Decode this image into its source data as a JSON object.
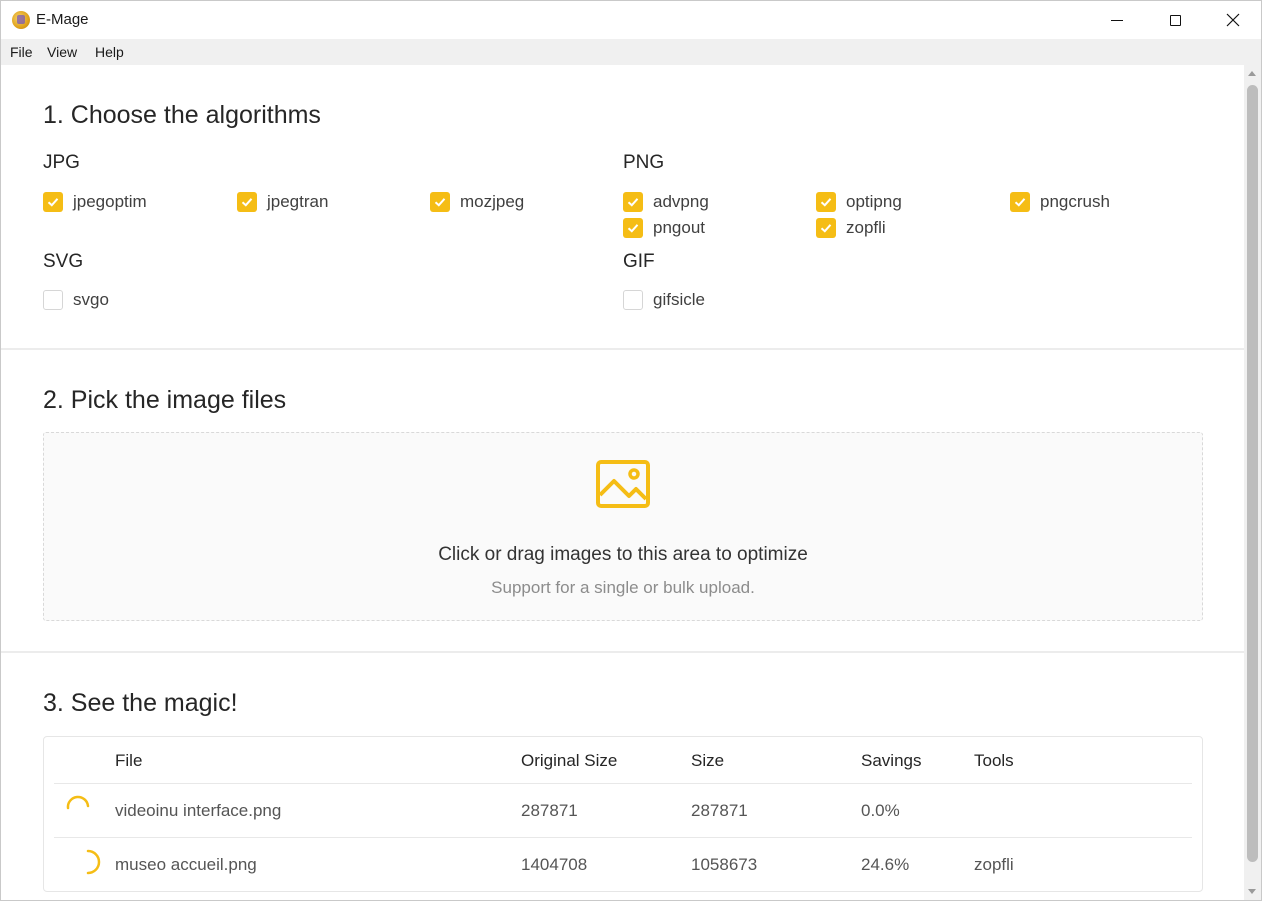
{
  "window": {
    "title": "E-Mage"
  },
  "menu": {
    "items": [
      "File",
      "View",
      "Help"
    ]
  },
  "section1": {
    "title": "1. Choose the algorithms",
    "groups": [
      {
        "name": "JPG",
        "options": [
          {
            "label": "jpegoptim",
            "checked": true
          },
          {
            "label": "jpegtran",
            "checked": true
          },
          {
            "label": "mozjpeg",
            "checked": true
          }
        ]
      },
      {
        "name": "PNG",
        "options": [
          {
            "label": "advpng",
            "checked": true
          },
          {
            "label": "optipng",
            "checked": true
          },
          {
            "label": "pngcrush",
            "checked": true
          },
          {
            "label": "pngout",
            "checked": true
          },
          {
            "label": "zopfli",
            "checked": true
          }
        ]
      },
      {
        "name": "SVG",
        "options": [
          {
            "label": "svgo",
            "checked": false
          }
        ]
      },
      {
        "name": "GIF",
        "options": [
          {
            "label": "gifsicle",
            "checked": false
          }
        ]
      }
    ]
  },
  "section2": {
    "title": "2. Pick the image files",
    "dropzone": {
      "icon": "image-icon",
      "text": "Click or drag images to this area to optimize",
      "hint": "Support for a single or bulk upload."
    }
  },
  "section3": {
    "title": "3. See the magic!",
    "columns": [
      "File",
      "Original Size",
      "Size",
      "Savings",
      "Tools"
    ],
    "rows": [
      {
        "file": "videoinu interface.png",
        "original": "287871",
        "size": "287871",
        "savings": "0.0%",
        "tools": ""
      },
      {
        "file": "museo accueil.png",
        "original": "1404708",
        "size": "1058673",
        "savings": "24.6%",
        "tools": "zopfli"
      }
    ]
  },
  "colors": {
    "accent": "#f5bd15",
    "menubar": "#f0f0f0",
    "divider": "#ececec"
  }
}
